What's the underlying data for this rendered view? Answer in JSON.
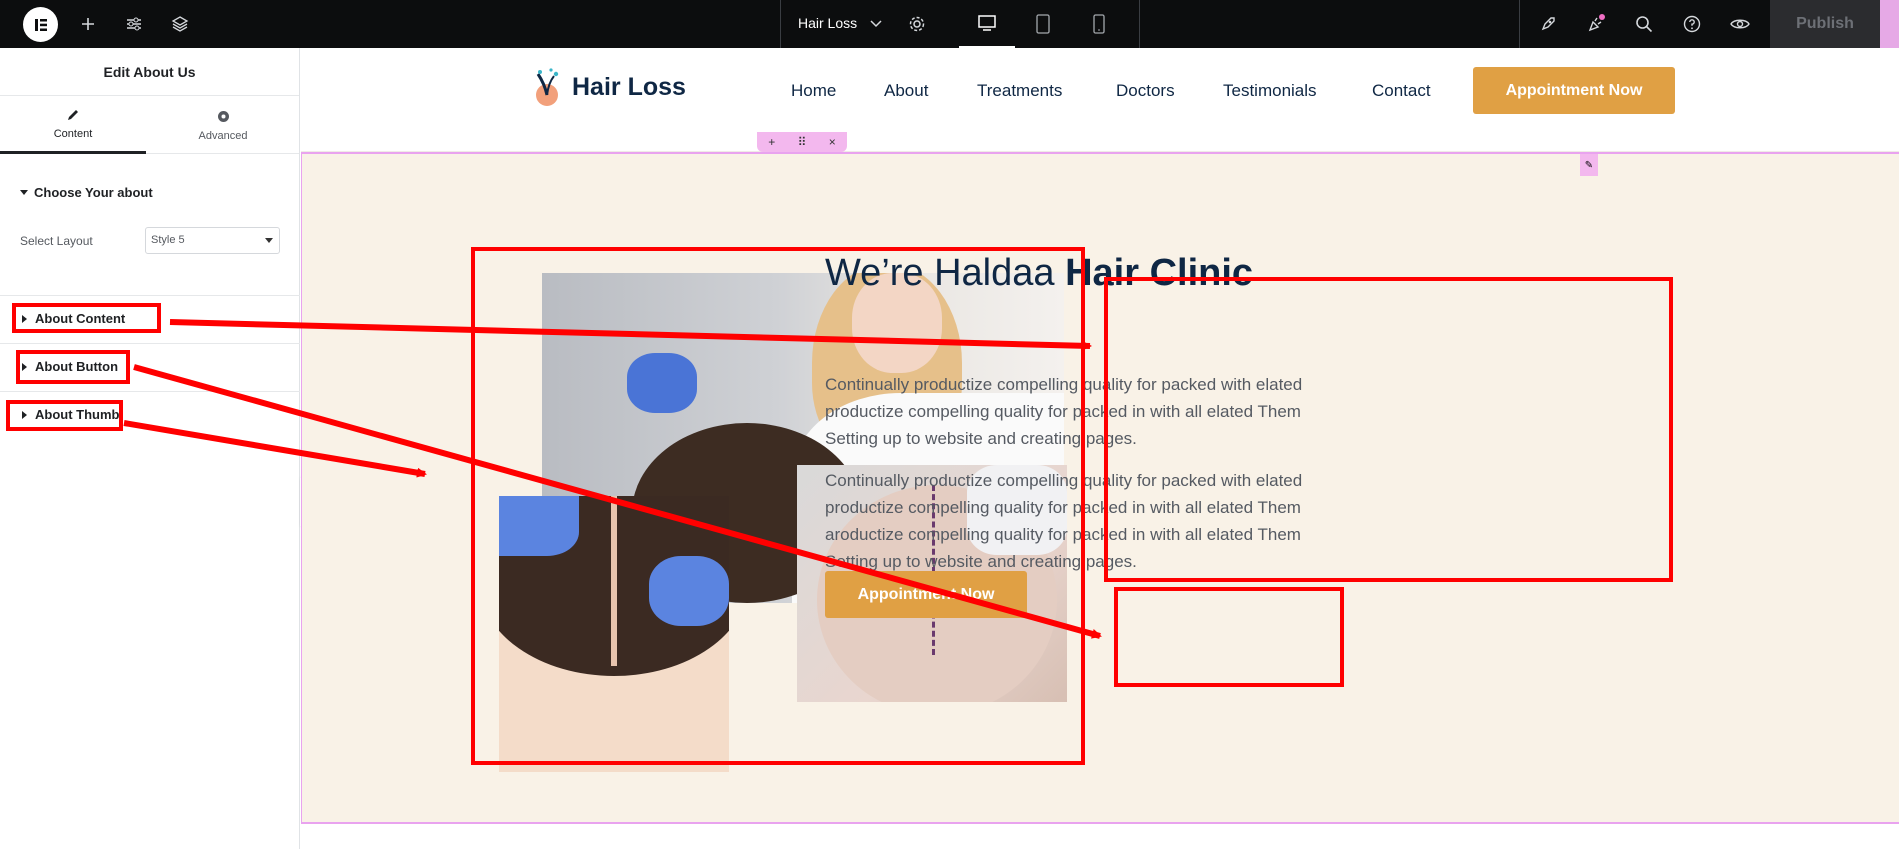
{
  "topbar": {
    "doc_title": "Hair Loss",
    "publish_label": "Publish"
  },
  "panel": {
    "title": "Edit About Us",
    "tabs": [
      {
        "label": "Content"
      },
      {
        "label": "Advanced"
      }
    ],
    "section_title": "Choose Your about",
    "select_layout_label": "Select Layout",
    "select_layout_value": "Style 5",
    "accordions": [
      {
        "label": "About Content"
      },
      {
        "label": "About Button"
      },
      {
        "label": "About Thumb"
      }
    ]
  },
  "site": {
    "brand": "Hair Loss",
    "nav": [
      "Home",
      "About",
      "Treatments",
      "Doctors",
      "Testimonials",
      "Contact"
    ],
    "header_cta": "Appointment Now"
  },
  "about": {
    "heading_light": "We’re Haldaa ",
    "heading_bold": "Hair Clinic",
    "para1": "Continually productize compelling quality for packed with elated productize compelling quality for packed in with all elated Them Setting up to website and creating pages.",
    "para2": "Continually productize compelling quality for packed with elated productize compelling quality for packed in with all elated Them aroductize compelling quality for packed in with all elated Them Setting up to website and creating pages.",
    "button_label": "Appointment Now"
  },
  "colors": {
    "accent": "#e0a044",
    "navy": "#0f2744",
    "section_bg": "#f9f2e7",
    "annotation": "#ff0000"
  }
}
